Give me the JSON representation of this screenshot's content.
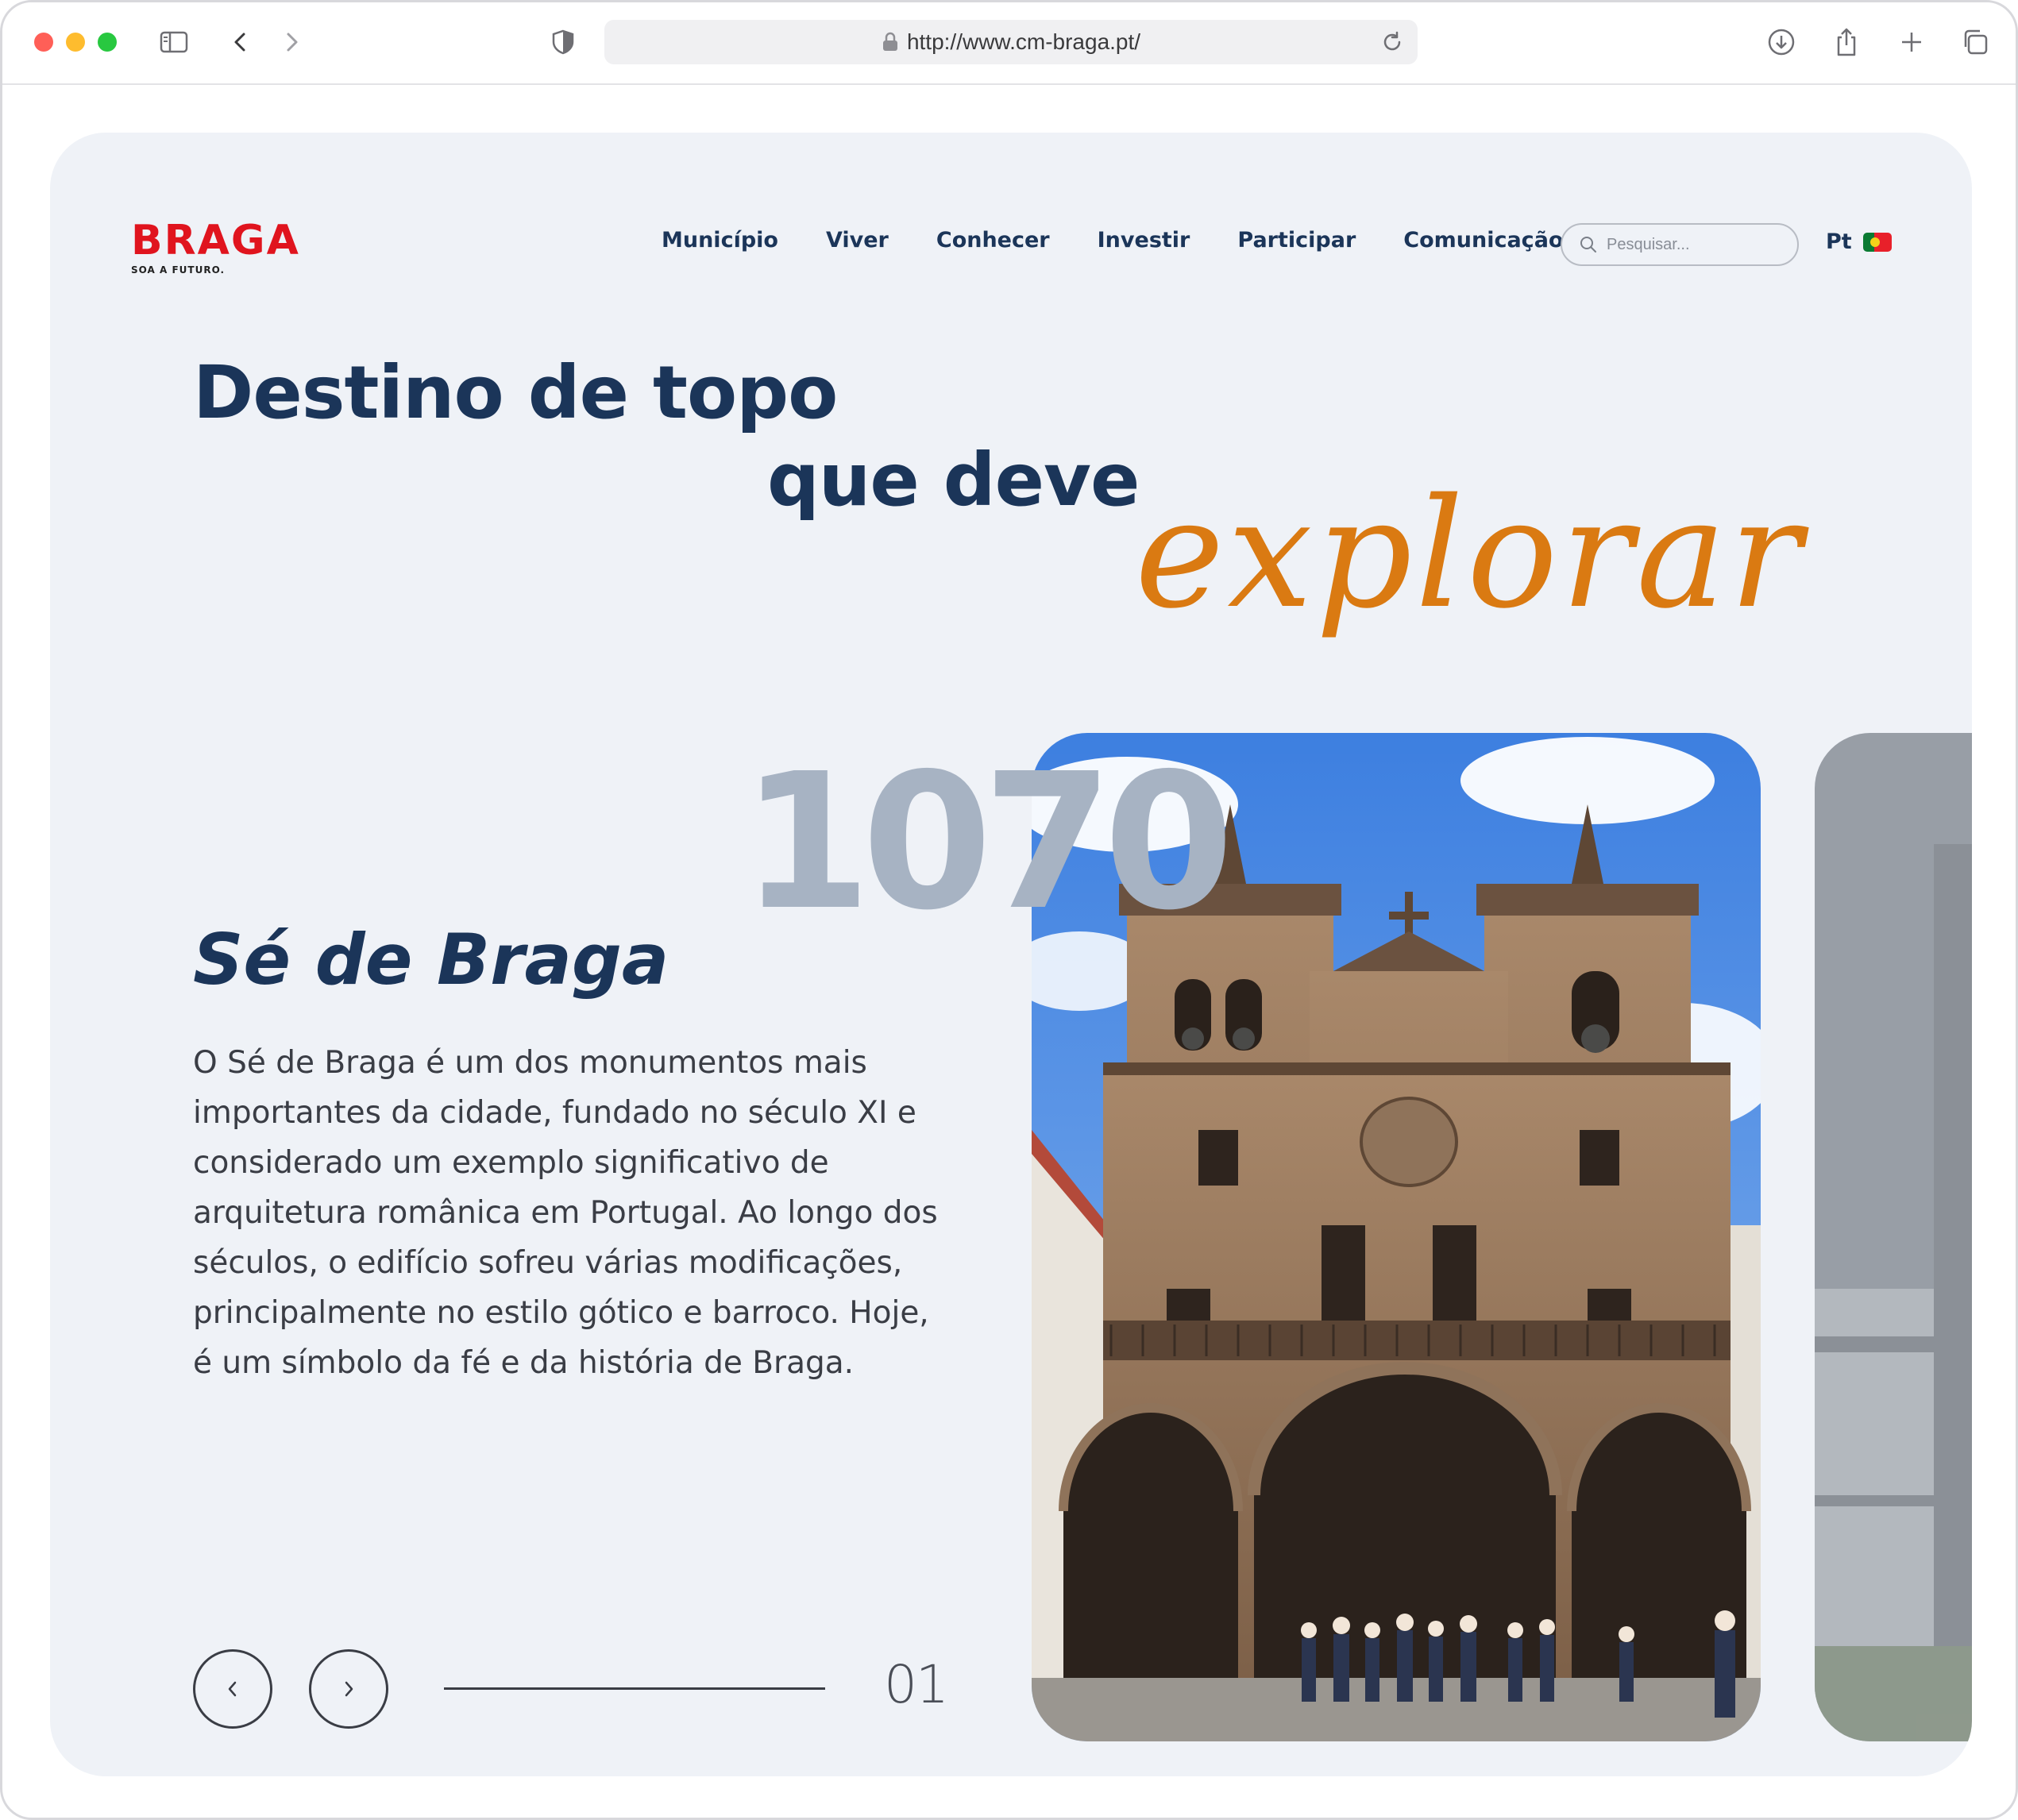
{
  "browser": {
    "url": "http://www.cm-braga.pt/"
  },
  "site": {
    "logo_text": "BRAGA",
    "logo_tagline": "SOA A FUTURO.",
    "nav": [
      "Município",
      "Viver",
      "Conhecer",
      "Investir",
      "Participar",
      "Comunicação"
    ],
    "search_placeholder": "Pesquisar...",
    "language": "Pt"
  },
  "hero": {
    "line1": "Destino de topo",
    "line2": "que deve",
    "line3": "explorar"
  },
  "slide": {
    "year": "1070",
    "title": "Sé de Braga",
    "description": "O Sé de Braga é um dos monumentos mais importantes da cidade, fundado no século XI e considerado um exemplo significativo de arquitetura românica em Portugal. Ao longo dos séculos, o edifício sofreu várias modificações, principalmente no estilo gótico e barroco. Hoje, é um símbolo da fé e da história de Braga.",
    "counter": "01"
  },
  "colors": {
    "navy": "#1b3559",
    "accent_orange": "#da7a12",
    "logo_red": "#e0141e",
    "year_gray": "#a7b3c3",
    "page_bg": "#eff2f7"
  },
  "icons": {
    "sidebar": "sidebar-icon",
    "back": "chevron-left-icon",
    "forward": "chevron-right-icon",
    "shield": "shield-icon",
    "lock": "lock-icon",
    "reload": "reload-icon",
    "download": "download-icon",
    "share": "share-icon",
    "new_tab": "plus-icon",
    "tabs": "tabs-icon",
    "search": "search-icon",
    "flag": "portugal-flag-icon"
  }
}
